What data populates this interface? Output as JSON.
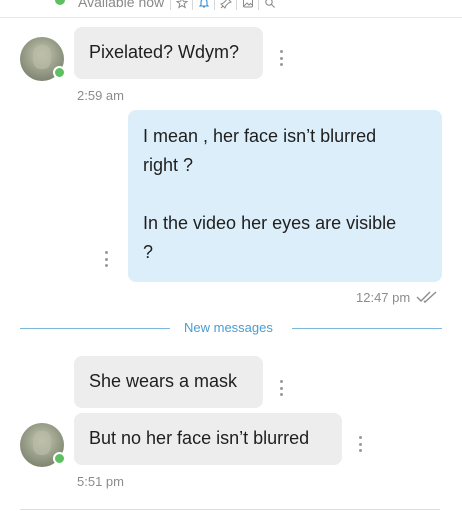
{
  "header": {
    "status_text": "Available now",
    "online_color": "#5cbf60",
    "icons": [
      "star-icon",
      "bell-icon",
      "pin-icon",
      "image-icon",
      "search-icon"
    ]
  },
  "messages": [
    {
      "direction": "incoming",
      "text": "Pixelated? Wdym?"
    },
    {
      "direction": "incoming",
      "time": "2:59 am"
    },
    {
      "direction": "outgoing",
      "text": "I mean , her face isn’t blurred\nright ?\n\nIn the video her eyes are visible\n?",
      "time": "12:47 pm",
      "status": "read"
    },
    {
      "direction": "incoming",
      "text": "She wears a mask"
    },
    {
      "direction": "incoming",
      "text": "But no her face isn’t blurred",
      "time": "5:51 pm"
    }
  ],
  "divider": {
    "label": "New messages",
    "color": "#4a9dd0"
  },
  "colors": {
    "incoming_bubble": "#ededed",
    "outgoing_bubble": "#dbeef9"
  }
}
